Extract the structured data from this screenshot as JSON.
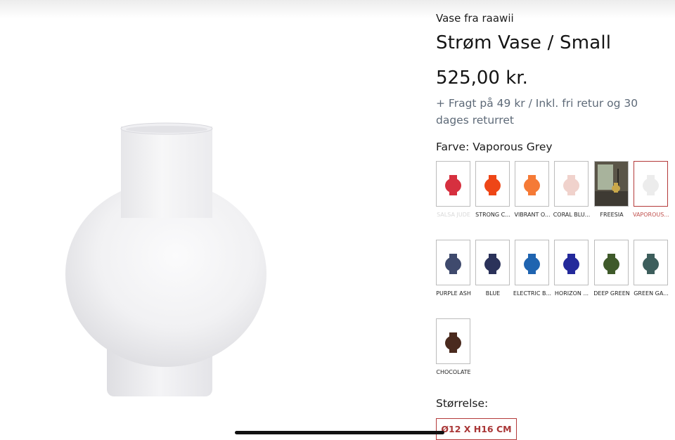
{
  "product": {
    "brand": "Vase fra raawii",
    "title": "Strøm Vase / Small",
    "price": "525,00 kr.",
    "shipping": "+ Fragt på 49 kr / Inkl. fri retur og 30 dages returret"
  },
  "color": {
    "label": "Farve: Vaporous Grey",
    "swatches": [
      {
        "name": "SALSA JUDE",
        "color": "#d6303f",
        "faded": true
      },
      {
        "name": "STRONG C...",
        "color": "#ee4617"
      },
      {
        "name": "VIBRANT O...",
        "color": "#f57a36"
      },
      {
        "name": "CORAL BLU...",
        "color": "#f0d2cc"
      },
      {
        "name": "FREESIA",
        "color": "#c9a84a",
        "photo": true
      },
      {
        "name": "VAPOROUS...",
        "color": "#ececec",
        "selected": true
      },
      {
        "name": "PURPLE ASH",
        "color": "#3f4a6d"
      },
      {
        "name": "BLUE",
        "color": "#2b325a"
      },
      {
        "name": "ELECTRIC B...",
        "color": "#1f64b0"
      },
      {
        "name": "HORIZON ...",
        "color": "#23299b"
      },
      {
        "name": "DEEP GREEN",
        "color": "#3f5a2a"
      },
      {
        "name": "GREEN GA...",
        "color": "#3d5e5c"
      },
      {
        "name": "CHOCOLATE",
        "color": "#4a2a1e"
      }
    ]
  },
  "size": {
    "label": "Størrelse:",
    "selected": "Ø12 X H16 CM"
  },
  "colors": {
    "accent": "#b43a3a",
    "muted_text": "#5e6a78"
  }
}
